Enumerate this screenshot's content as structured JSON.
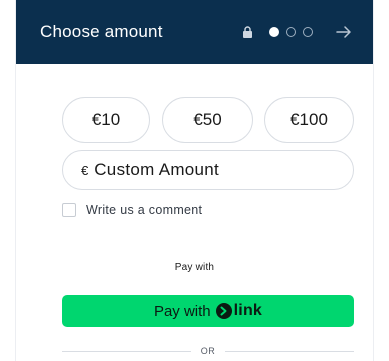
{
  "header": {
    "title": "Choose amount",
    "lock_icon": "lock-icon",
    "steps_total": 3,
    "steps_active": 1,
    "next_icon": "arrow-right-icon"
  },
  "amounts": [
    {
      "label": "€10"
    },
    {
      "label": "€50"
    },
    {
      "label": "€100"
    }
  ],
  "custom_amount": {
    "currency": "€",
    "placeholder": "Custom Amount",
    "value": ""
  },
  "comment": {
    "label": "Write us a comment",
    "checked": false
  },
  "payment": {
    "pay_with_label": "Pay with",
    "link_button_prefix": "Pay with",
    "link_wordmark": "link",
    "or_label": "OR"
  },
  "colors": {
    "header_bg": "#0b2f4e",
    "link_green": "#00d66f",
    "border": "#d9dde3"
  }
}
